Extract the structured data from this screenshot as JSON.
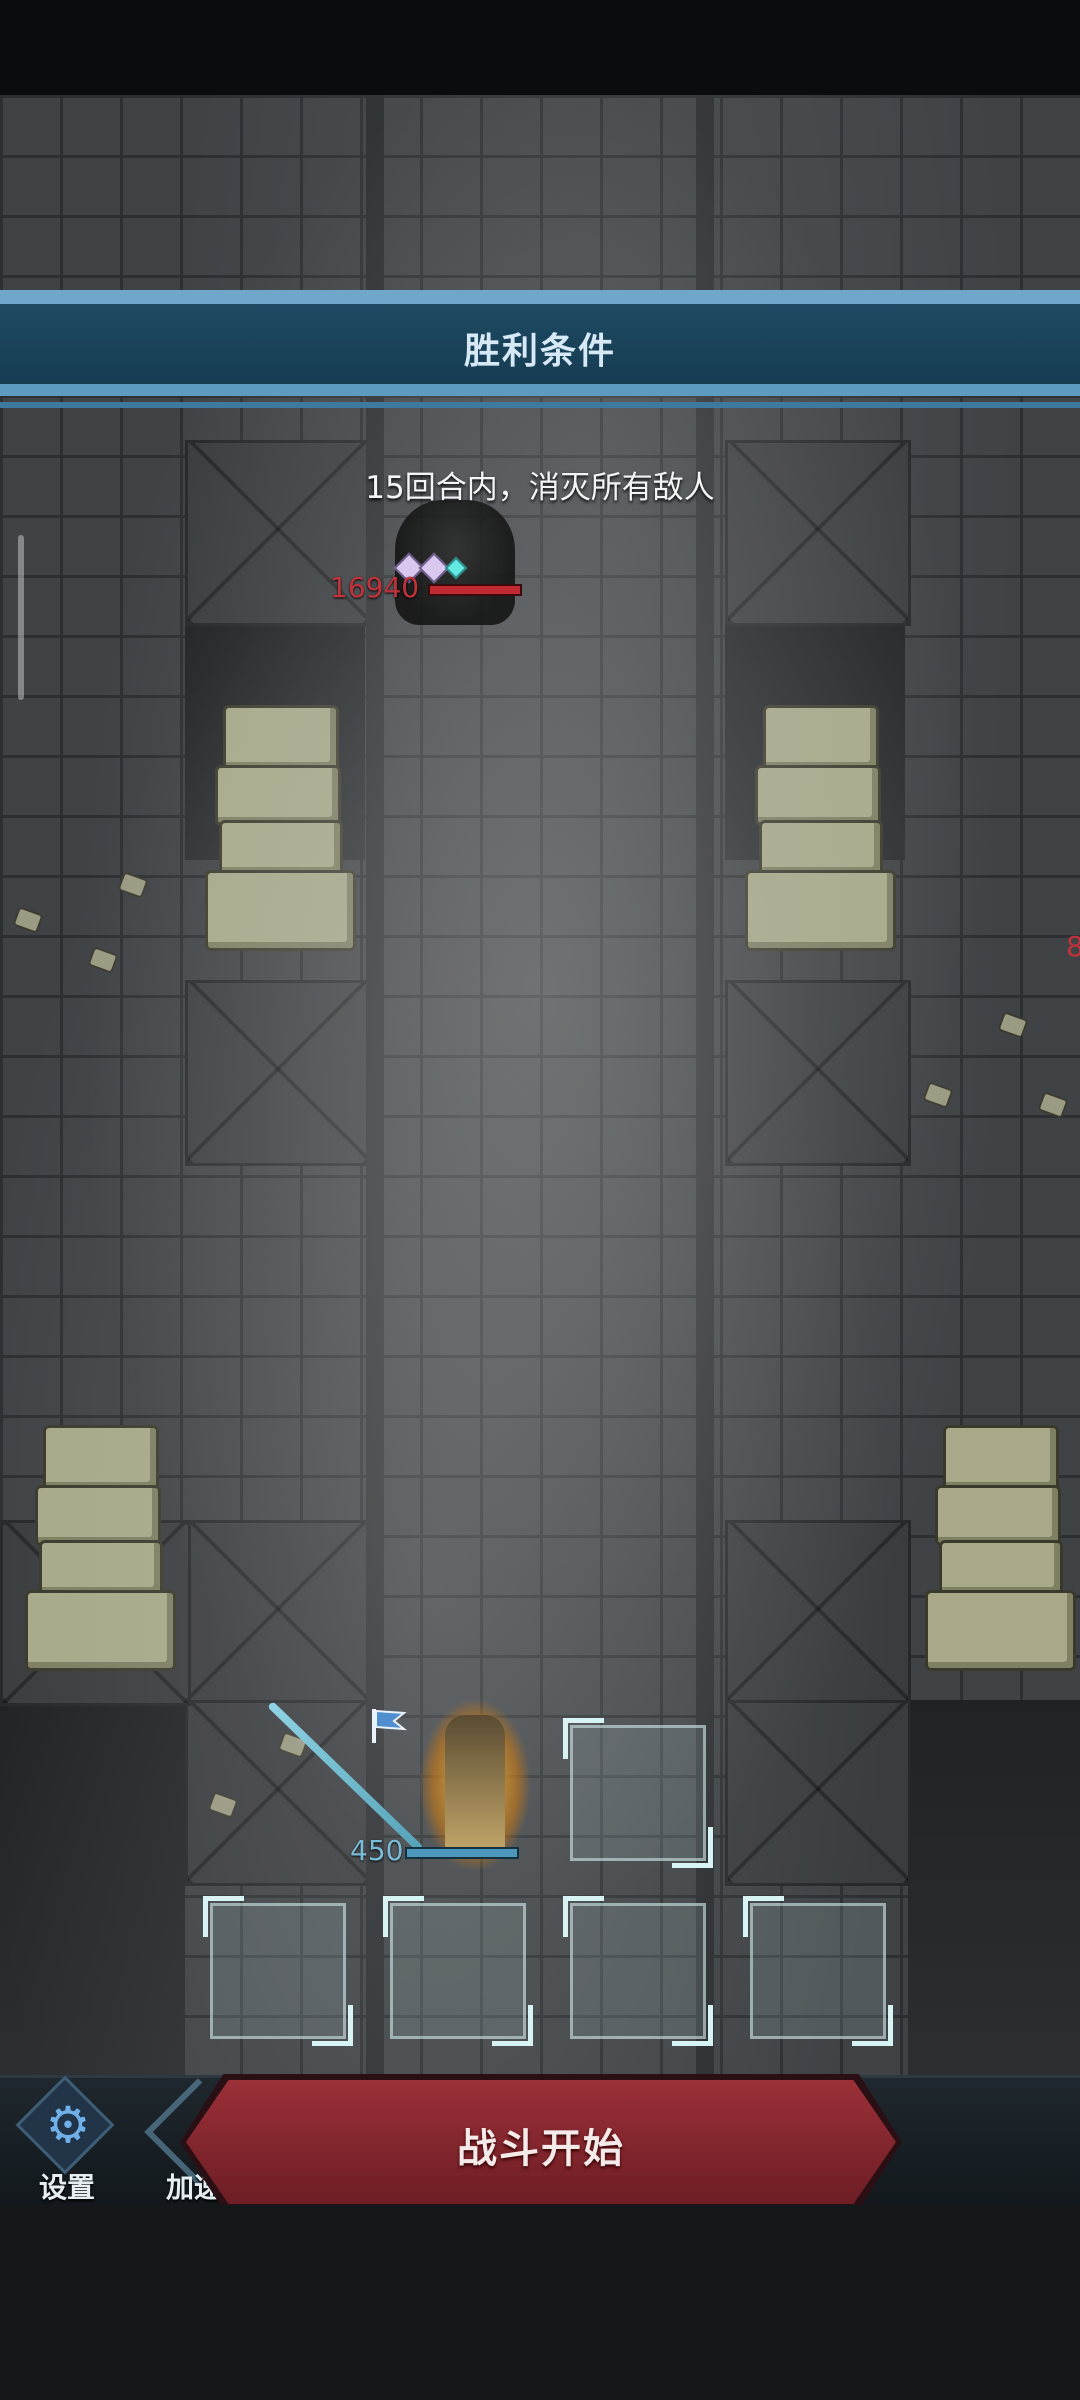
{
  "banner": {
    "title": "胜利条件"
  },
  "objective": "15回合内，消灭所有敌人",
  "enemy": {
    "hp": "16940"
  },
  "hero": {
    "hp": "450"
  },
  "edge_value": "8",
  "bottom": {
    "settings_label": "设置",
    "speed_label": "加速",
    "start_label": "战斗开始"
  },
  "icons": [
    "gear-icon",
    "flag-icon",
    "speed-chevron-icon",
    "gem-icon"
  ],
  "colors": {
    "banner": "#1d4a62",
    "start_button": "#9b3038",
    "enemy_hp": "#c0333b",
    "hero_hp": "#4d97bd"
  }
}
